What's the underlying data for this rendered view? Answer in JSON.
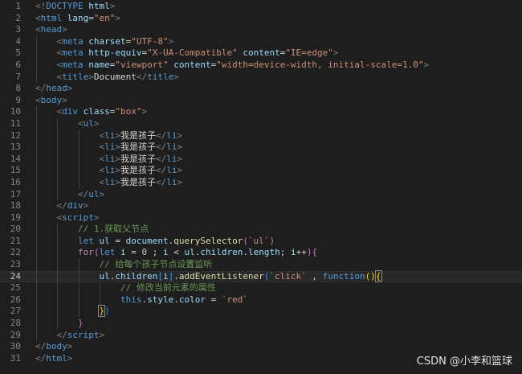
{
  "lines": [
    {
      "n": "1",
      "segs": [
        [
          "tag-bracket",
          "<!"
        ],
        [
          "tag",
          "DOCTYPE"
        ],
        [
          "txt",
          " "
        ],
        [
          "attr",
          "html"
        ],
        [
          "tag-bracket",
          ">"
        ]
      ]
    },
    {
      "n": "2",
      "segs": [
        [
          "tag-bracket",
          "<"
        ],
        [
          "tag",
          "html"
        ],
        [
          "txt",
          " "
        ],
        [
          "attr",
          "lang"
        ],
        [
          "txt",
          "="
        ],
        [
          "str",
          "\"en\""
        ],
        [
          "tag-bracket",
          ">"
        ]
      ]
    },
    {
      "n": "3",
      "segs": [
        [
          "tag-bracket",
          "<"
        ],
        [
          "tag",
          "head"
        ],
        [
          "tag-bracket",
          ">"
        ]
      ]
    },
    {
      "n": "4",
      "segs": [
        [
          "txt",
          "    "
        ],
        [
          "tag-bracket",
          "<"
        ],
        [
          "tag",
          "meta"
        ],
        [
          "txt",
          " "
        ],
        [
          "attr",
          "charset"
        ],
        [
          "txt",
          "="
        ],
        [
          "str",
          "\"UTF-8\""
        ],
        [
          "tag-bracket",
          ">"
        ]
      ]
    },
    {
      "n": "5",
      "segs": [
        [
          "txt",
          "    "
        ],
        [
          "tag-bracket",
          "<"
        ],
        [
          "tag",
          "meta"
        ],
        [
          "txt",
          " "
        ],
        [
          "attr",
          "http-equiv"
        ],
        [
          "txt",
          "="
        ],
        [
          "str",
          "\"X-UA-Compatible\""
        ],
        [
          "txt",
          " "
        ],
        [
          "attr",
          "content"
        ],
        [
          "txt",
          "="
        ],
        [
          "str",
          "\"IE=edge\""
        ],
        [
          "tag-bracket",
          ">"
        ]
      ]
    },
    {
      "n": "6",
      "segs": [
        [
          "txt",
          "    "
        ],
        [
          "tag-bracket",
          "<"
        ],
        [
          "tag",
          "meta"
        ],
        [
          "txt",
          " "
        ],
        [
          "attr",
          "name"
        ],
        [
          "txt",
          "="
        ],
        [
          "str",
          "\"viewport\""
        ],
        [
          "txt",
          " "
        ],
        [
          "attr",
          "content"
        ],
        [
          "txt",
          "="
        ],
        [
          "str",
          "\"width=device-width, initial-scale=1.0\""
        ],
        [
          "tag-bracket",
          ">"
        ]
      ]
    },
    {
      "n": "7",
      "segs": [
        [
          "txt",
          "    "
        ],
        [
          "tag-bracket",
          "<"
        ],
        [
          "tag",
          "title"
        ],
        [
          "tag-bracket",
          ">"
        ],
        [
          "txt",
          "Document"
        ],
        [
          "tag-bracket",
          "</"
        ],
        [
          "tag",
          "title"
        ],
        [
          "tag-bracket",
          ">"
        ]
      ]
    },
    {
      "n": "8",
      "segs": [
        [
          "tag-bracket",
          "</"
        ],
        [
          "tag",
          "head"
        ],
        [
          "tag-bracket",
          ">"
        ]
      ]
    },
    {
      "n": "9",
      "segs": [
        [
          "tag-bracket",
          "<"
        ],
        [
          "tag",
          "body"
        ],
        [
          "tag-bracket",
          ">"
        ]
      ]
    },
    {
      "n": "10",
      "segs": [
        [
          "txt",
          "    "
        ],
        [
          "tag-bracket",
          "<"
        ],
        [
          "tag",
          "div"
        ],
        [
          "txt",
          " "
        ],
        [
          "attr",
          "class"
        ],
        [
          "txt",
          "="
        ],
        [
          "str",
          "\"box\""
        ],
        [
          "tag-bracket",
          ">"
        ]
      ]
    },
    {
      "n": "11",
      "segs": [
        [
          "txt",
          "        "
        ],
        [
          "tag-bracket",
          "<"
        ],
        [
          "tag",
          "ul"
        ],
        [
          "tag-bracket",
          ">"
        ]
      ]
    },
    {
      "n": "12",
      "segs": [
        [
          "txt",
          "            "
        ],
        [
          "tag-bracket",
          "<"
        ],
        [
          "tag",
          "li"
        ],
        [
          "tag-bracket",
          ">"
        ],
        [
          "txt",
          "我是孩子"
        ],
        [
          "tag-bracket",
          "</"
        ],
        [
          "tag",
          "li"
        ],
        [
          "tag-bracket",
          ">"
        ]
      ]
    },
    {
      "n": "13",
      "segs": [
        [
          "txt",
          "            "
        ],
        [
          "tag-bracket",
          "<"
        ],
        [
          "tag",
          "li"
        ],
        [
          "tag-bracket",
          ">"
        ],
        [
          "txt",
          "我是孩子"
        ],
        [
          "tag-bracket",
          "</"
        ],
        [
          "tag",
          "li"
        ],
        [
          "tag-bracket",
          ">"
        ]
      ]
    },
    {
      "n": "14",
      "segs": [
        [
          "txt",
          "            "
        ],
        [
          "tag-bracket",
          "<"
        ],
        [
          "tag",
          "li"
        ],
        [
          "tag-bracket",
          ">"
        ],
        [
          "txt",
          "我是孩子"
        ],
        [
          "tag-bracket",
          "</"
        ],
        [
          "tag",
          "li"
        ],
        [
          "tag-bracket",
          ">"
        ]
      ]
    },
    {
      "n": "15",
      "segs": [
        [
          "txt",
          "            "
        ],
        [
          "tag-bracket",
          "<"
        ],
        [
          "tag",
          "li"
        ],
        [
          "tag-bracket",
          ">"
        ],
        [
          "txt",
          "我是孩子"
        ],
        [
          "tag-bracket",
          "</"
        ],
        [
          "tag",
          "li"
        ],
        [
          "tag-bracket",
          ">"
        ]
      ]
    },
    {
      "n": "16",
      "segs": [
        [
          "txt",
          "            "
        ],
        [
          "tag-bracket",
          "<"
        ],
        [
          "tag",
          "li"
        ],
        [
          "tag-bracket",
          ">"
        ],
        [
          "txt",
          "我是孩子"
        ],
        [
          "tag-bracket",
          "</"
        ],
        [
          "tag",
          "li"
        ],
        [
          "tag-bracket",
          ">"
        ]
      ]
    },
    {
      "n": "17",
      "segs": [
        [
          "txt",
          "        "
        ],
        [
          "tag-bracket",
          "</"
        ],
        [
          "tag",
          "ul"
        ],
        [
          "tag-bracket",
          ">"
        ]
      ]
    },
    {
      "n": "18",
      "segs": [
        [
          "txt",
          "    "
        ],
        [
          "tag-bracket",
          "</"
        ],
        [
          "tag",
          "div"
        ],
        [
          "tag-bracket",
          ">"
        ]
      ]
    },
    {
      "n": "19",
      "segs": [
        [
          "txt",
          "    "
        ],
        [
          "tag-bracket",
          "<"
        ],
        [
          "tag",
          "script"
        ],
        [
          "tag-bracket",
          ">"
        ]
      ]
    },
    {
      "n": "20",
      "segs": [
        [
          "txt",
          "        "
        ],
        [
          "cmt",
          "// 1.获取父节点"
        ]
      ]
    },
    {
      "n": "21",
      "segs": [
        [
          "txt",
          "        "
        ],
        [
          "kw",
          "let"
        ],
        [
          "txt",
          " "
        ],
        [
          "var",
          "ul"
        ],
        [
          "txt",
          " = "
        ],
        [
          "var",
          "document"
        ],
        [
          "txt",
          "."
        ],
        [
          "fn",
          "querySelector"
        ],
        [
          "br2",
          "("
        ],
        [
          "str",
          "`ul`"
        ],
        [
          "br2",
          ")"
        ]
      ]
    },
    {
      "n": "22",
      "segs": [
        [
          "txt",
          "        "
        ],
        [
          "kw2",
          "for"
        ],
        [
          "br2",
          "("
        ],
        [
          "kw",
          "let"
        ],
        [
          "txt",
          " "
        ],
        [
          "var",
          "i"
        ],
        [
          "txt",
          " = "
        ],
        [
          "num",
          "0"
        ],
        [
          "txt",
          " ; "
        ],
        [
          "var",
          "i"
        ],
        [
          "txt",
          " < "
        ],
        [
          "var",
          "ul"
        ],
        [
          "txt",
          "."
        ],
        [
          "var",
          "children"
        ],
        [
          "txt",
          "."
        ],
        [
          "var",
          "length"
        ],
        [
          "txt",
          "; "
        ],
        [
          "var",
          "i"
        ],
        [
          "txt",
          "++"
        ],
        [
          "br2",
          ")"
        ],
        [
          "br2",
          "{"
        ]
      ]
    },
    {
      "n": "23",
      "segs": [
        [
          "txt",
          "            "
        ],
        [
          "cmt",
          "// 给每个孩子节点设置监听"
        ]
      ]
    },
    {
      "n": "24",
      "current": true,
      "segs": [
        [
          "txt",
          "            "
        ],
        [
          "var",
          "ul"
        ],
        [
          "txt",
          "."
        ],
        [
          "var",
          "children"
        ],
        [
          "br3",
          "["
        ],
        [
          "var",
          "i"
        ],
        [
          "br3",
          "]"
        ],
        [
          "txt",
          "."
        ],
        [
          "fn",
          "addEventListener"
        ],
        [
          "br3",
          "("
        ],
        [
          "str",
          "`click`"
        ],
        [
          "txt",
          " , "
        ],
        [
          "kw",
          "function"
        ],
        [
          "br1",
          "("
        ],
        [
          "br1",
          ")"
        ],
        [
          "br1m",
          "{"
        ]
      ]
    },
    {
      "n": "25",
      "segs": [
        [
          "txt",
          "                "
        ],
        [
          "cmt",
          "// 修改当前元素的属性"
        ]
      ]
    },
    {
      "n": "26",
      "segs": [
        [
          "txt",
          "                "
        ],
        [
          "kw",
          "this"
        ],
        [
          "txt",
          "."
        ],
        [
          "var",
          "style"
        ],
        [
          "txt",
          "."
        ],
        [
          "var",
          "color"
        ],
        [
          "txt",
          " = "
        ],
        [
          "str",
          "`red`"
        ]
      ]
    },
    {
      "n": "27",
      "segs": [
        [
          "txt",
          "            "
        ],
        [
          "br1m",
          "}"
        ],
        [
          "br3",
          ")"
        ]
      ]
    },
    {
      "n": "28",
      "segs": [
        [
          "txt",
          "        "
        ],
        [
          "br2",
          "}"
        ]
      ]
    },
    {
      "n": "29",
      "segs": [
        [
          "txt",
          "    "
        ],
        [
          "tag-bracket",
          "</"
        ],
        [
          "tag",
          "script"
        ],
        [
          "tag-bracket",
          ">"
        ]
      ]
    },
    {
      "n": "30",
      "segs": [
        [
          "tag-bracket",
          "</"
        ],
        [
          "tag",
          "body"
        ],
        [
          "tag-bracket",
          ">"
        ]
      ]
    },
    {
      "n": "31",
      "segs": [
        [
          "tag-bracket",
          "</"
        ],
        [
          "tag",
          "html"
        ],
        [
          "tag-bracket",
          ">"
        ]
      ]
    }
  ],
  "watermark": "CSDN @小李和篮球"
}
